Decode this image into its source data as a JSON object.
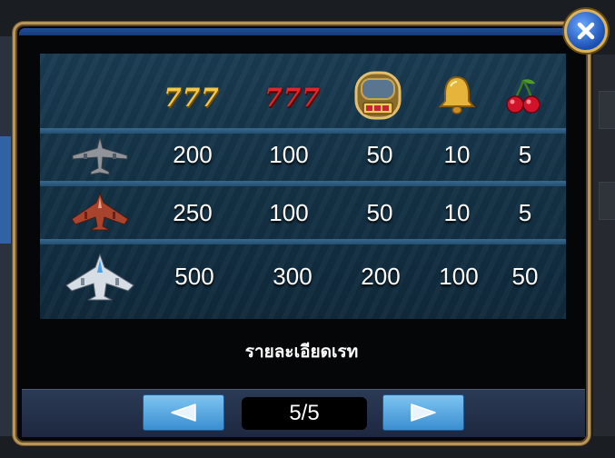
{
  "close_icon": "close-x-icon",
  "header_symbols": [
    {
      "name": "gold-777-icon",
      "text": "777",
      "color": "#f3c846"
    },
    {
      "name": "red-777-icon",
      "text": "777",
      "color": "#e0262a"
    },
    {
      "name": "slot-machine-icon"
    },
    {
      "name": "bell-icon"
    },
    {
      "name": "cherry-icon"
    }
  ],
  "rows": [
    {
      "icon": "gray-bomber-plane-icon",
      "values": [
        "200",
        "100",
        "50",
        "10",
        "5"
      ]
    },
    {
      "icon": "red-fighter-jet-icon",
      "values": [
        "250",
        "100",
        "50",
        "10",
        "5"
      ]
    },
    {
      "icon": "white-spaceship-icon",
      "values": [
        "500",
        "300",
        "200",
        "100",
        "50"
      ]
    }
  ],
  "footer": {
    "label": "รายละเอียดเรท",
    "page": "5/5"
  },
  "colors": {
    "frame": "#b8965a",
    "button": "#3a8ed0",
    "table": "#143246"
  }
}
